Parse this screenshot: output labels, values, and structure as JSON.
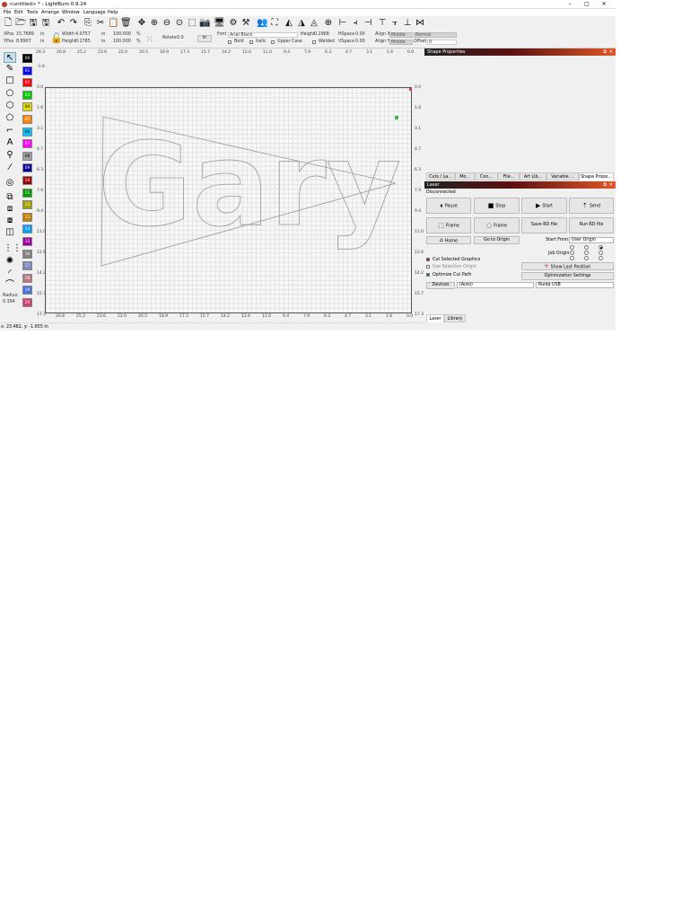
{
  "window": {
    "title": "<untitled> * - LightBurn 0.9.24",
    "min": "–",
    "max": "□",
    "close": "✕"
  },
  "menu": [
    "File",
    "Edit",
    "Tools",
    "Arrange",
    "Window",
    "Language",
    "Help"
  ],
  "props": {
    "xpos_label": "XPos",
    "xpos": "15.7689",
    "ypos_label": "YPos",
    "ypos": "8.8907",
    "unit": "in",
    "width_label": "Width",
    "width": "4.0757",
    "height_label": "Height",
    "height": "0.2785",
    "scale_w": "100.000",
    "scale_h": "100.000",
    "pct": "%",
    "rotate_label": "Rotate",
    "rotate": "0.0",
    "unit_btn": "in",
    "font_label": "Font",
    "font": "Arial Black",
    "text_height_label": "Height",
    "text_height": "0.2968",
    "hspace_label": "HSpace",
    "hspace": "0.00",
    "vspace_label": "VSpace",
    "vspace": "0.00",
    "align_x_label": "Align X",
    "align_x": "Middle",
    "align_y_label": "Align Y",
    "align_y": "Middle",
    "mode": "Normal",
    "offset_label": "Offset",
    "offset": "0",
    "bold": "Bold",
    "italic": "Italic",
    "upper_case": "Upper Case",
    "welded": "Welded"
  },
  "palette": [
    {
      "id": "00",
      "color": "#000000"
    },
    {
      "id": "01",
      "color": "#0000ff"
    },
    {
      "id": "02",
      "color": "#ff0000"
    },
    {
      "id": "03",
      "color": "#00cc00"
    },
    {
      "id": "04",
      "color": "#e0e000"
    },
    {
      "id": "05",
      "color": "#ff8000"
    },
    {
      "id": "06",
      "color": "#00c8ff"
    },
    {
      "id": "07",
      "color": "#ff00ff"
    },
    {
      "id": "08",
      "color": "#a0a0a0"
    },
    {
      "id": "09",
      "color": "#0000a0"
    },
    {
      "id": "10",
      "color": "#a00000"
    },
    {
      "id": "11",
      "color": "#00a000"
    },
    {
      "id": "12",
      "color": "#a0a000"
    },
    {
      "id": "13",
      "color": "#c08000"
    },
    {
      "id": "14",
      "color": "#00a0ff"
    },
    {
      "id": "15",
      "color": "#a000a0"
    },
    {
      "id": "16",
      "color": "#808080"
    },
    {
      "id": "17",
      "color": "#7d87b9"
    },
    {
      "id": "18",
      "color": "#bb7784"
    },
    {
      "id": "19",
      "color": "#4a6fe3"
    },
    {
      "id": "20",
      "color": "#d33f6a"
    }
  ],
  "radius": {
    "label": "Radius:",
    "value": "0.394"
  },
  "ruler_top": [
    "28.3",
    "26.8",
    "25.2",
    "23.6",
    "22.0",
    "20.5",
    "18.9",
    "17.3",
    "15.7",
    "14.2",
    "12.6",
    "11.0",
    "9.4",
    "7.9",
    "6.3",
    "4.7",
    "3.1",
    "1.6",
    "0.0"
  ],
  "ruler_left": [
    "-1.6",
    "0.0",
    "1.6",
    "3.1",
    "4.7",
    "6.3",
    "7.9",
    "9.4",
    "11.0",
    "12.6",
    "14.2",
    "15.7",
    "17.3"
  ],
  "ruler_right": [
    "0.0",
    "1.6",
    "3.1",
    "4.7",
    "6.3",
    "7.9",
    "9.4",
    "11.0",
    "12.6",
    "14.2",
    "15.7",
    "17.3"
  ],
  "ruler_bottom": [
    "28.3",
    "26.8",
    "25.2",
    "23.6",
    "22.0",
    "20.5",
    "18.9",
    "17.3",
    "15.7",
    "14.2",
    "12.6",
    "11.0",
    "9.4",
    "7.9",
    "6.3",
    "4.7",
    "3.1",
    "1.6",
    "0.0"
  ],
  "canvas_text": "Gary",
  "status": "x: 23.482, y: -1.655 in",
  "shape_panel": {
    "title": "Shape Properties",
    "tabs": [
      "Cuts / La...",
      "Mo...",
      "Con...",
      "File...",
      "Art Lib...",
      "Variable ...",
      "Shape Prope..."
    ]
  },
  "laser": {
    "title": "Laser",
    "state": "Disconnected",
    "pause": "Pause",
    "stop": "Stop",
    "start": "Start",
    "send": "Send",
    "frame1": "Frame",
    "frame2": "Frame",
    "save_rd": "Save RD file",
    "run_rd": "Run RD file",
    "home": "Home",
    "go_origin": "Go to Origin",
    "start_from_label": "Start From:",
    "start_from": "User Origin",
    "job_origin_label": "Job Origin",
    "cut_selected": "Cut Selected Graphics",
    "use_selection": "Use Selection Origin",
    "optimize": "Optimize Cut Path",
    "show_last": "Show Last Position",
    "opt_settings": "Optimization Settings",
    "devices": "Devices",
    "port": "(Auto)",
    "device": "Ruida USB",
    "tabs": [
      "Laser",
      "Library"
    ]
  }
}
